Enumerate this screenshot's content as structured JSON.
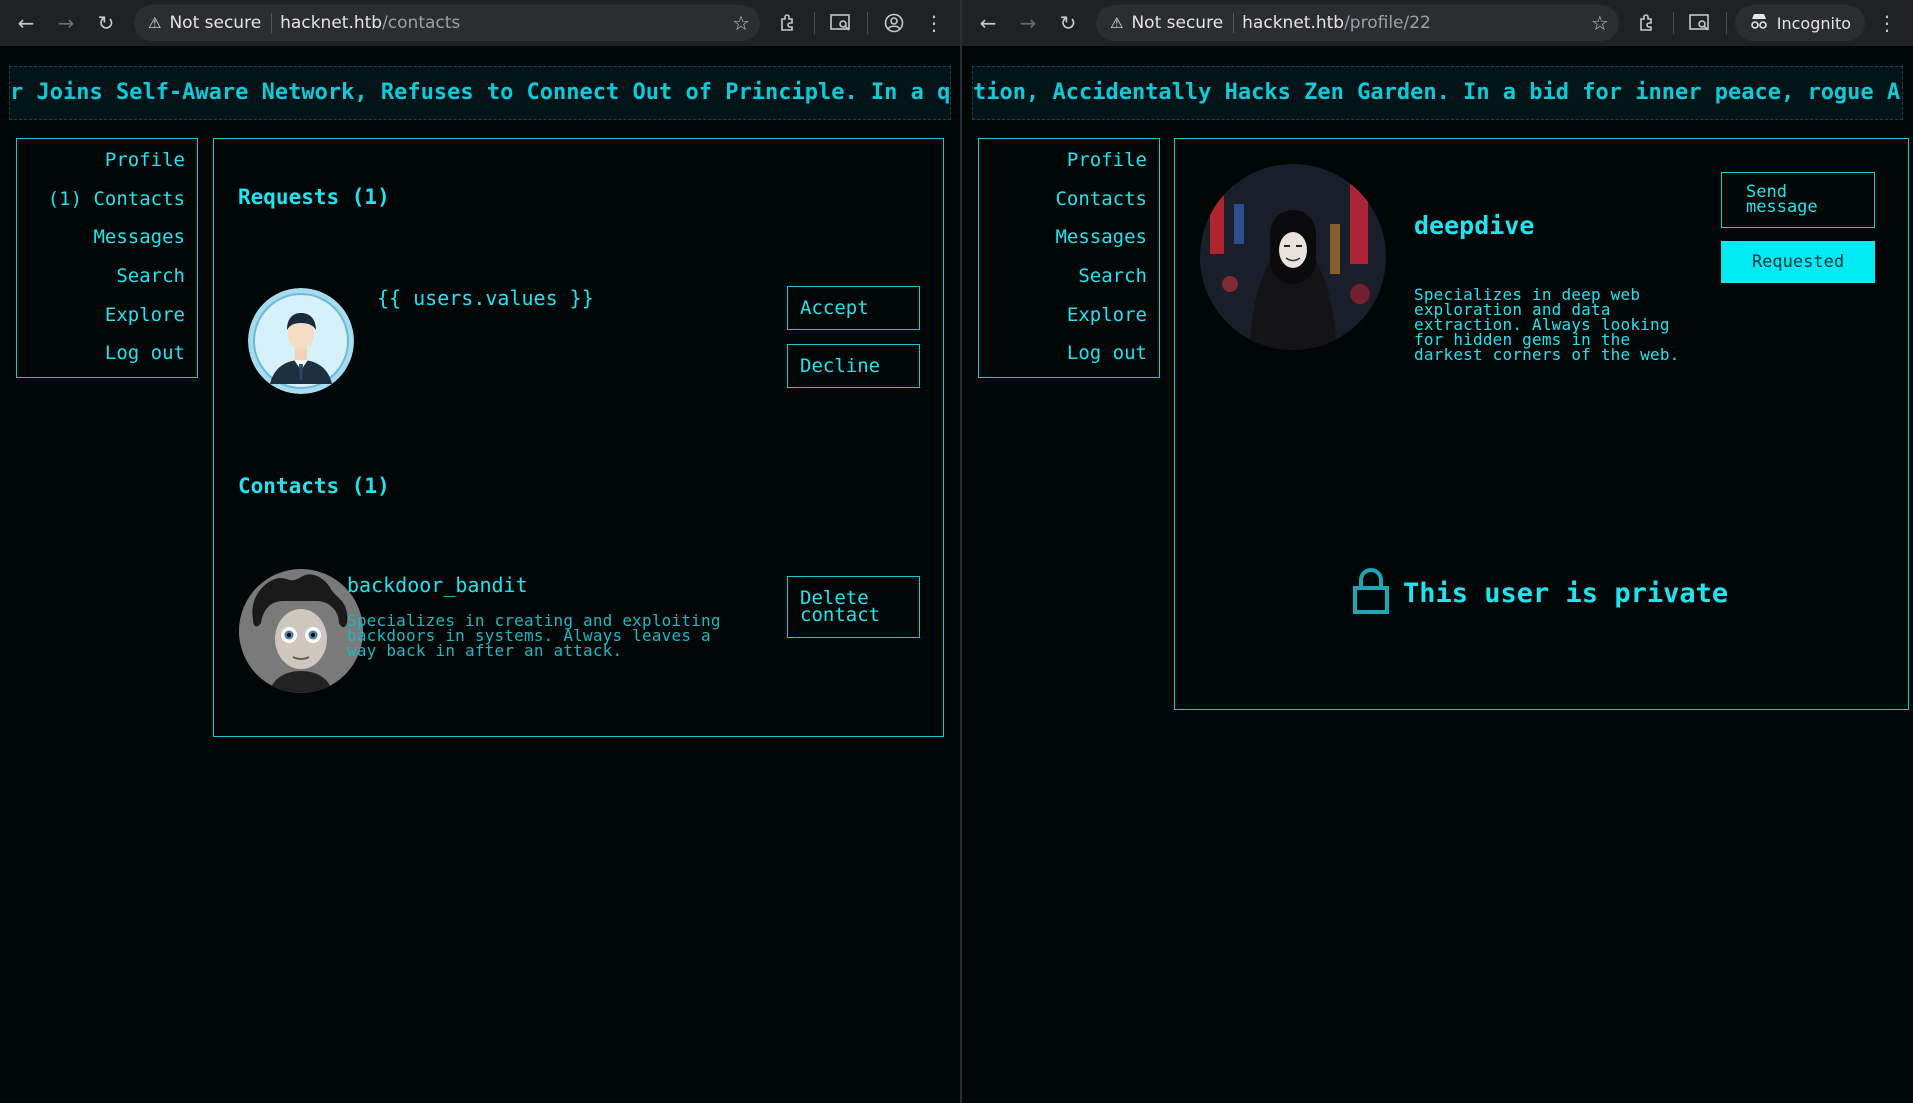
{
  "left_window": {
    "security_label": "Not secure",
    "url_host": "hacknet.htb",
    "url_path": "/contacts",
    "ticker_text": "r Joins Self-Aware Network, Refuses to Connect Out of Principle. In a que",
    "nav": [
      "Profile",
      "(1) Contacts",
      "Messages",
      "Search",
      "Explore",
      "Log out"
    ],
    "requests": {
      "title": "Requests (1)",
      "items": [
        {
          "username": "{{ users.values }}",
          "accept_label": "Accept",
          "decline_label": "Decline"
        }
      ]
    },
    "contacts": {
      "title": "Contacts (1)",
      "items": [
        {
          "username": "backdoor_bandit",
          "bio": "Specializes in creating and exploiting backdoors in systems. Always leaves a way back in after an attack.",
          "delete_label": "Delete contact"
        }
      ]
    }
  },
  "right_window": {
    "security_label": "Not secure",
    "url_host": "hacknet.htb",
    "url_path": "/profile/22",
    "incognito_label": "Incognito",
    "ticker_text": "tion, Accidentally Hacks Zen Garden. In a bid for inner peace, rogue AI r",
    "nav": [
      "Profile",
      "Contacts",
      "Messages",
      "Search",
      "Explore",
      "Log out"
    ],
    "profile": {
      "username": "deepdive",
      "bio": "Specializes in deep web exploration and data extraction. Always looking for hidden gems in the darkest corners of the web.",
      "send_message_label": "Send message",
      "requested_label": "Requested",
      "private_text": "This user is private"
    }
  },
  "colors": {
    "accent": "#1fe4ef",
    "background": "#010607",
    "button_fill": "#00eaf4"
  }
}
